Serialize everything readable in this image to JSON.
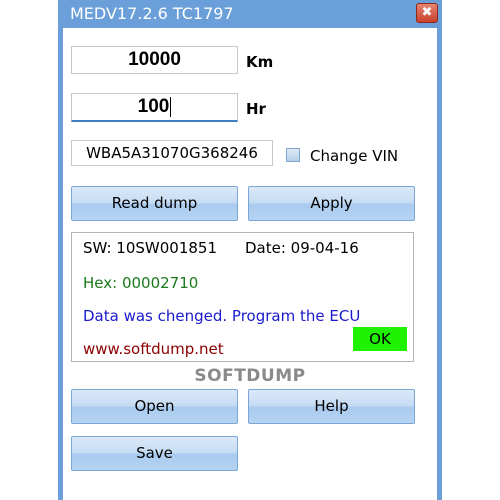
{
  "window": {
    "title": "MEDV17.2.6 TC1797",
    "close_glyph": "✖"
  },
  "fields": {
    "km_value": "10000",
    "km_unit": "Km",
    "hr_value": "100",
    "hr_unit": "Hr",
    "vin_value": "WBA5A31070G368246",
    "change_vin_label": "Change VIN",
    "change_vin_checked": false
  },
  "buttons": {
    "read_dump": "Read dump",
    "apply": "Apply",
    "open": "Open",
    "help": "Help",
    "save": "Save"
  },
  "info": {
    "sw": "SW: 10SW001851",
    "date": "Date: 09-04-16",
    "hex": "Hex: 00002710",
    "message": "Data was chenged. Program the ECU",
    "website": "www.softdump.net",
    "ok": "OK"
  },
  "brand": "SOFTDUMP",
  "colors": {
    "titlebar": "#6a9fd9",
    "hex_text": "#1b7a1b",
    "message_text": "#1a1acc",
    "website_text": "#8b0000",
    "ok_badge": "#1ef200"
  },
  "icons": {
    "close": "close-icon",
    "checkbox": "checkbox-icon"
  }
}
